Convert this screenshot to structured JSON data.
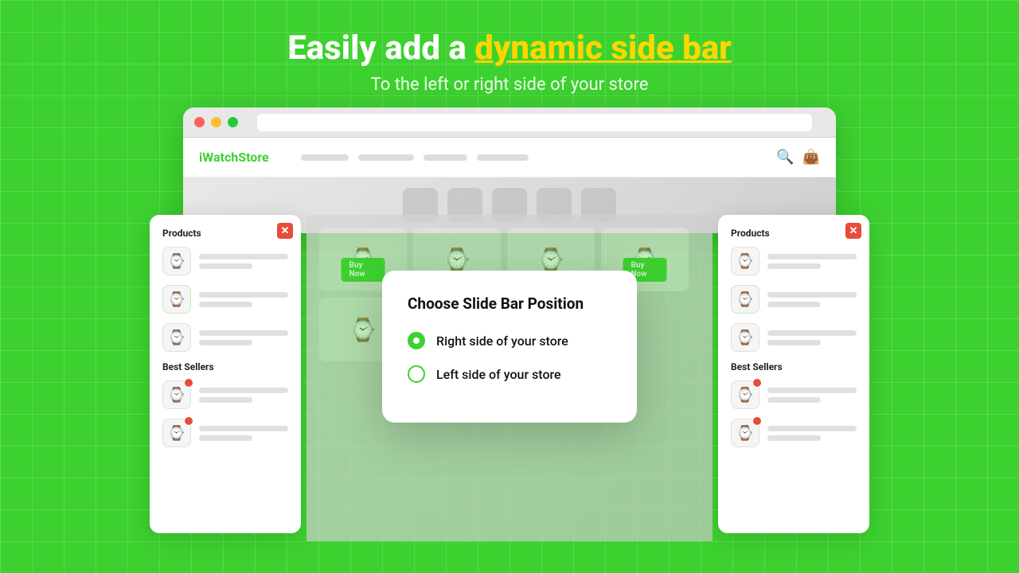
{
  "hero": {
    "title_start": "Easily add a ",
    "title_highlight": "dynamic side bar",
    "subtitle": "To the left or right side of your store"
  },
  "browser": {
    "store_name_i": "i",
    "store_name_rest": "WatchStore"
  },
  "modal": {
    "title": "Choose Slide Bar Position",
    "option_right": "Right side of your store",
    "option_left": "Left side of your store",
    "selected": "right"
  },
  "panel": {
    "section1": "Products",
    "section2": "Best Sellers",
    "close_icon": "✕"
  },
  "traffic_lights": {
    "red": "#ff5f56",
    "yellow": "#ffbd2e",
    "green": "#27c93f"
  }
}
